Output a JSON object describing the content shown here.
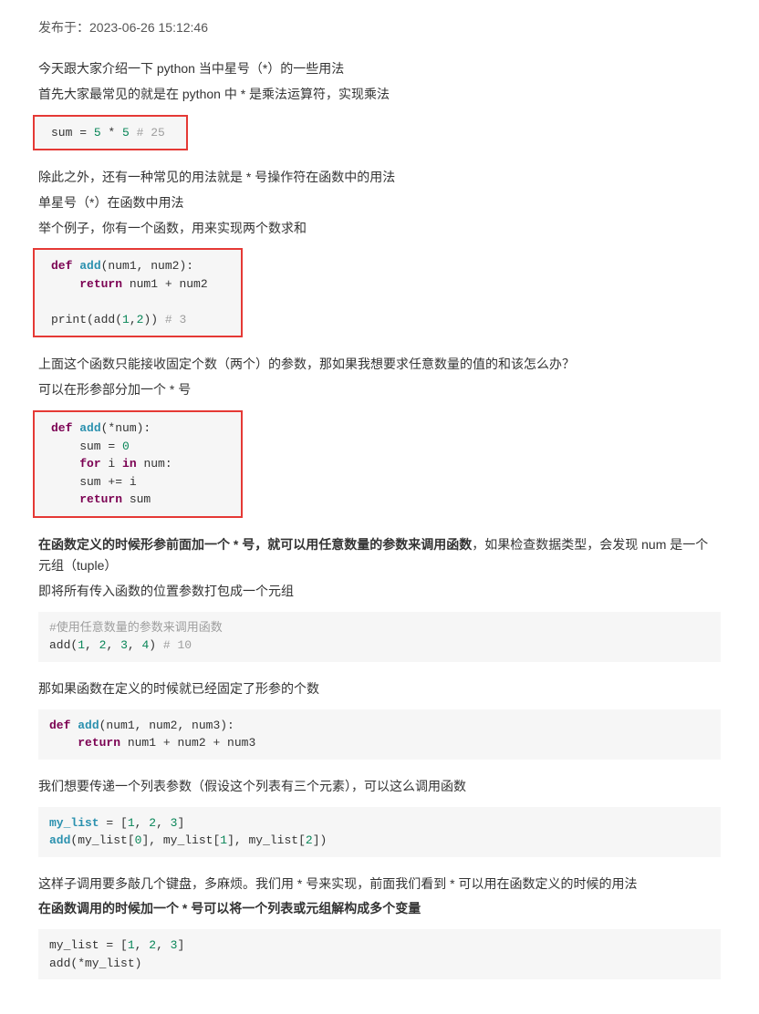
{
  "meta": {
    "published_label": "发布于：",
    "published_at": "2023-06-26 15:12:46"
  },
  "p1": "今天跟大家介绍一下 python 当中星号（*）的一些用法",
  "p2": "首先大家最常见的就是在 python 中 * 是乘法运算符，实现乘法",
  "code1": {
    "a": "sum = ",
    "n1": "5",
    "op": " * ",
    "n2": "5",
    "cm": " # 25"
  },
  "p3": "除此之外，还有一种常见的用法就是 * 号操作符在函数中的用法",
  "p4": "单星号（*）在函数中用法",
  "p5": "举个例子，你有一个函数，用来实现两个数求和",
  "code2": {
    "l1a": "def ",
    "l1b": "add",
    "l1c": "(num1, num2):",
    "l2a": "    ",
    "l2b": "return",
    "l2c": " num1 + num2",
    "l3a": "print(add(",
    "l3n1": "1",
    "l3m": ",",
    "l3n2": "2",
    "l3b": ")) ",
    "l3cm": "# 3"
  },
  "p6": "上面这个函数只能接收固定个数（两个）的参数，那如果我想要求任意数量的值的和该怎么办？",
  "p7": "可以在形参部分加一个 * 号",
  "code3": {
    "l1a": "def ",
    "l1b": "add",
    "l1c": "(*num):",
    "l2a": "    sum = ",
    "l2n": "0",
    "l3a": "    ",
    "l3b": "for",
    "l3c": " i ",
    "l3d": "in",
    "l3e": " num:",
    "l4": "    sum += i",
    "l5a": "    ",
    "l5b": "return",
    "l5c": " sum"
  },
  "p8a": "在函数定义的时候形参前面加一个 * 号，就可以用任意数量的参数来调用函数",
  "p8b": "，如果检查数据类型，会发现 num 是一个元组（tuple）",
  "p9": "即将所有传入函数的位置参数打包成一个元组",
  "code4": {
    "l1": "#使用任意数量的参数来调用函数",
    "l2a": "add(",
    "l2n1": "1",
    "l2m1": ", ",
    "l2n2": "2",
    "l2m2": ", ",
    "l2n3": "3",
    "l2m3": ", ",
    "l2n4": "4",
    "l2b": ") ",
    "l2cm": "# 10"
  },
  "p10": "那如果函数在定义的时候就已经固定了形参的个数",
  "code5": {
    "l1a": "def ",
    "l1b": "add",
    "l1c": "(num1, num2, num3):",
    "l2a": "    ",
    "l2b": "return",
    "l2c": " num1 + num2 + num3"
  },
  "p11": "我们想要传递一个列表参数（假设这个列表有三个元素），可以这么调用函数",
  "code6": {
    "l1a": "my_list",
    "l1b": " = [",
    "l1n1": "1",
    "l1m1": ", ",
    "l1n2": "2",
    "l1m2": ", ",
    "l1n3": "3",
    "l1c": "]",
    "l2a": "add",
    "l2b": "(my_list[",
    "l2n0": "0",
    "l2c": "], my_list[",
    "l2n1": "1",
    "l2d": "], my_list[",
    "l2n2": "2",
    "l2e": "])"
  },
  "p12": "这样子调用要多敲几个键盘，多麻烦。我们用 * 号来实现，前面我们看到 * 可以用在函数定义的时候的用法",
  "p13": "在函数调用的时候加一个 * 号可以将一个列表或元组解构成多个变量",
  "code7": {
    "l1a": "my_list = [",
    "l1n1": "1",
    "l1m1": ", ",
    "l1n2": "2",
    "l1m2": ", ",
    "l1n3": "3",
    "l1b": "]",
    "l2": "add(*my_list)"
  }
}
